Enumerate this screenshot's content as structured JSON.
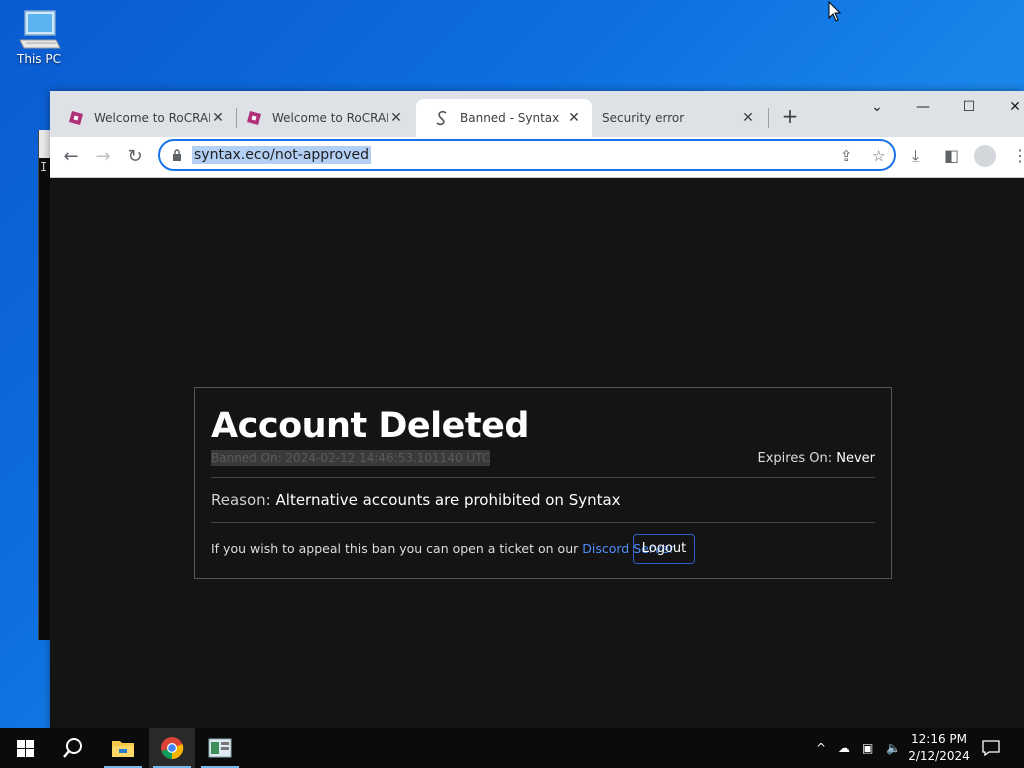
{
  "desktop": {
    "icons": [
      {
        "label": "This PC",
        "icon": "this-pc-icon"
      }
    ]
  },
  "background_window": {
    "text": "I"
  },
  "browser": {
    "tabs": [
      {
        "title": "Welcome to RoCRAFT",
        "icon": "rocraft-favicon",
        "active": false
      },
      {
        "title": "Welcome to RoCRAFT",
        "icon": "rocraft-favicon",
        "active": false
      },
      {
        "title": "Banned - Syntax",
        "icon": "syntax-favicon",
        "active": true
      },
      {
        "title": "Security error",
        "icon": "none",
        "active": false
      }
    ],
    "address_bar": {
      "url": "syntax.eco/not-approved"
    }
  },
  "ban_page": {
    "title": "Account Deleted",
    "banned_on": "Banned On: 2024-02-12 14:46:53.101140 UTC",
    "expires_label": "Expires On:",
    "expires_value": "Never",
    "reason_label": "Reason:",
    "reason_value": "Alternative accounts are prohibited on Syntax",
    "appeal_text": "If you wish to appeal this ban you can open a ticket on our",
    "appeal_link": "Discord Server",
    "logout_label": "Logout"
  },
  "taskbar": {
    "apps": [
      "start-icon",
      "search-icon",
      "file-explorer-icon",
      "chrome-icon",
      "app-icon"
    ],
    "clock": {
      "time": "12:16 PM",
      "date": "2/12/2024"
    }
  },
  "colors": {
    "page_bg": "#141414",
    "link": "#4d8ef7",
    "logout_border": "#2f5ec8",
    "omnibox_focus": "#1a73e8",
    "rocraft_favicon": "#b0307a"
  }
}
